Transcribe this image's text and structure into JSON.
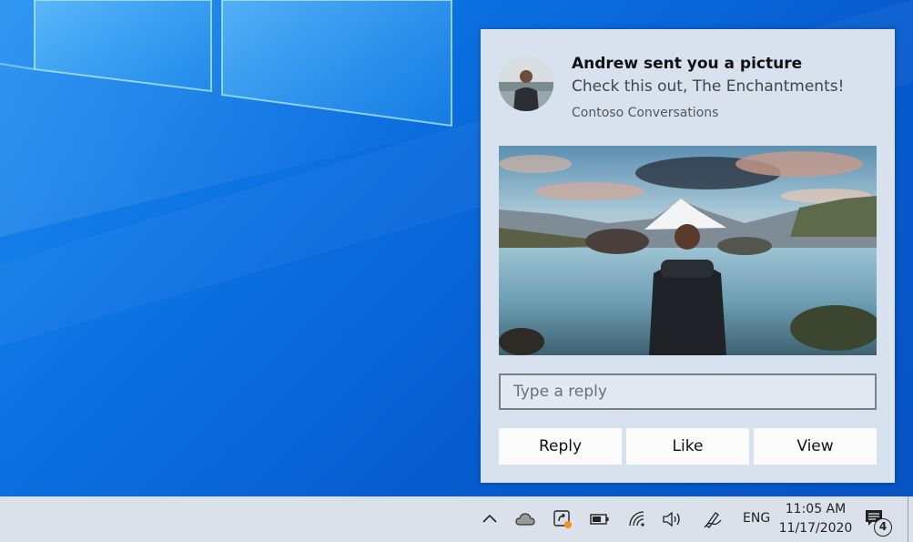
{
  "toast": {
    "title": "Andrew sent you a picture",
    "body": "Check this out, The Enchantments!",
    "attribution": "Contoso Conversations",
    "reply_placeholder": "Type a reply",
    "buttons": {
      "reply": "Reply",
      "like": "Like",
      "view": "View"
    }
  },
  "taskbar": {
    "tray_icons": [
      "chevron-up-icon",
      "onedrive-cloud-icon",
      "app-update-icon",
      "battery-icon",
      "wifi-icon",
      "volume-icon",
      "pen-workspace-icon"
    ],
    "language": "ENG",
    "time": "11:05 AM",
    "date": "11/17/2020",
    "notification_count": "4"
  },
  "colors": {
    "desktop_blue": "#0b6fe0",
    "toast_bg": "#d8e1ee",
    "taskbar_bg": "#dbe1ea",
    "update_dot": "#f7901e"
  }
}
